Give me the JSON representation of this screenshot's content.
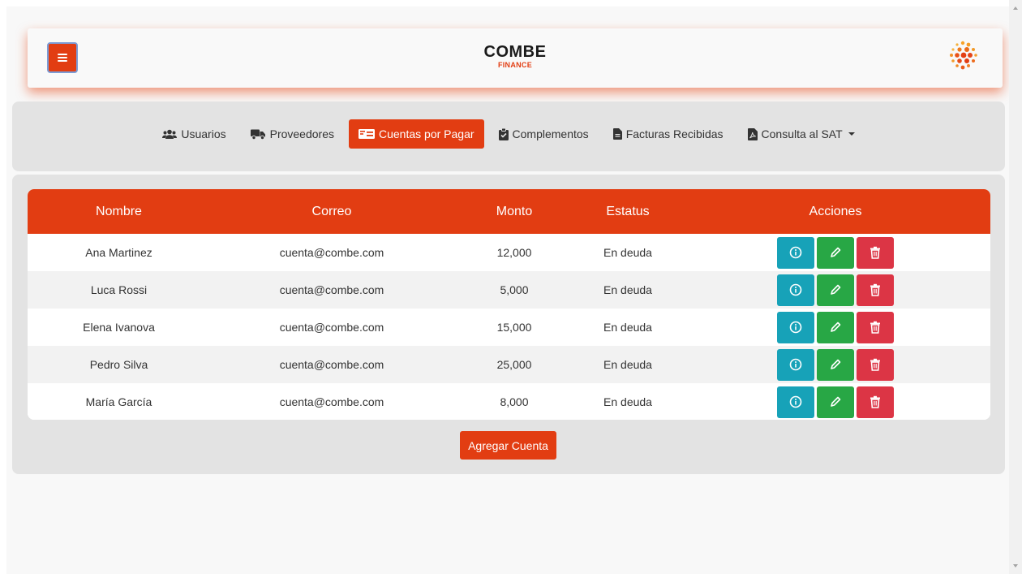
{
  "brand": {
    "name": "COMBE",
    "sub": "FINANCE",
    "accent": "#e23d12"
  },
  "nav": {
    "items": [
      {
        "label": "Usuarios",
        "icon": "users-icon",
        "active": false
      },
      {
        "label": "Proveedores",
        "icon": "truck-icon",
        "active": false
      },
      {
        "label": "Cuentas por Pagar",
        "icon": "money-bill-icon",
        "active": true
      },
      {
        "label": "Complementos",
        "icon": "clipboard-check-icon",
        "active": false
      },
      {
        "label": "Facturas Recibidas",
        "icon": "file-icon",
        "active": false
      },
      {
        "label": "Consulta al SAT",
        "icon": "file-pdf-icon",
        "active": false,
        "dropdown": true
      }
    ]
  },
  "table": {
    "headers": [
      "Nombre",
      "Correo",
      "Monto",
      "Estatus",
      "Acciones"
    ],
    "rows": [
      {
        "nombre": "Ana Martinez",
        "correo": "cuenta@combe.com",
        "monto": "12,000",
        "estatus": "En deuda"
      },
      {
        "nombre": "Luca Rossi",
        "correo": "cuenta@combe.com",
        "monto": "5,000",
        "estatus": "En deuda"
      },
      {
        "nombre": "Elena Ivanova",
        "correo": "cuenta@combe.com",
        "monto": "15,000",
        "estatus": "En deuda"
      },
      {
        "nombre": "Pedro Silva",
        "correo": "cuenta@combe.com",
        "monto": "25,000",
        "estatus": "En deuda"
      },
      {
        "nombre": "María García",
        "correo": "cuenta@combe.com",
        "monto": "8,000",
        "estatus": "En deuda"
      }
    ],
    "action_icons": [
      "info-icon",
      "pencil-icon",
      "trash-icon"
    ],
    "action_colors": {
      "info": "#17a2b8",
      "edit": "#28a745",
      "delete": "#dc3545"
    }
  },
  "add_button": {
    "label": "Agregar Cuenta"
  }
}
